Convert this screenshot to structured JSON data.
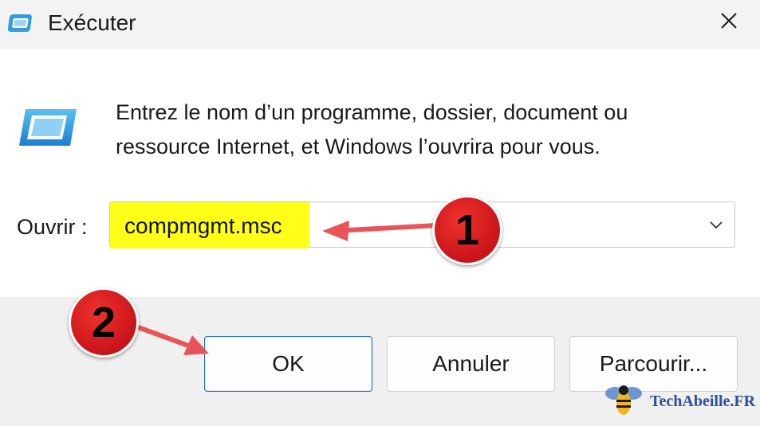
{
  "window": {
    "title": "Exécuter",
    "close_icon": "close-icon",
    "app_icon": "run-window-icon"
  },
  "content": {
    "description_line1": "Entrez le nom d’un programme, dossier, document ou",
    "description_line2": "ressource Internet, et Windows l’ouvrira pour vous.",
    "open_label": "Ouvrir :",
    "open_value": "compmgmt.msc",
    "highlight_color": "#ffff17"
  },
  "buttons": {
    "ok": "OK",
    "cancel": "Annuler",
    "browse": "Parcourir..."
  },
  "annotations": {
    "step1": "1",
    "step2": "2",
    "arrow_color": "#e8545a",
    "badge_color": "#d81e1e"
  },
  "watermark": {
    "text": "TechAbeille.FR"
  }
}
